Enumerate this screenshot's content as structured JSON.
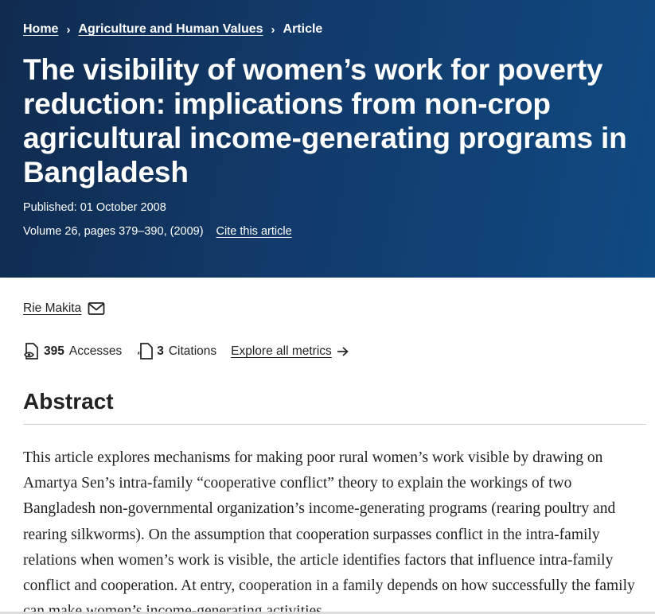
{
  "breadcrumb": {
    "items": [
      "Home",
      "Agriculture and Human Values"
    ],
    "current": "Article"
  },
  "article": {
    "title": "The visibility of women’s work for poverty reduction: implications from non-crop agricultural income-generating programs in Bangladesh",
    "published": "Published: 01 October 2008",
    "volume": "Volume 26, pages 379–390, (2009)",
    "cite_label": "Cite this article"
  },
  "author": {
    "name": "Rie Makita",
    "email_icon": "envelope-icon"
  },
  "metrics": {
    "accesses_count": "395",
    "accesses_label": "Accesses",
    "citations_count": "3",
    "citations_label": "Citations",
    "explore_label": "Explore all metrics",
    "accesses_icon": "eye-document-icon",
    "citations_icon": "quote-document-icon",
    "explore_icon": "arrow-right-icon"
  },
  "abstract": {
    "heading": "Abstract",
    "text": "This article explores mechanisms for making poor rural women’s work visible by drawing on Amartya Sen’s intra-family “cooperative conflict” theory to explain the workings of two Bangladesh non-governmental organization’s income-generating programs (rearing poultry and rearing silkworms). On the assumption that cooperation surpasses conflict in the intra-family relations when women’s work is visible, the article identifies factors that influence intra-family conflict and cooperation. At entry, cooperation in a family depends on how successfully the family can make women’s income-generating activities"
  },
  "colors": {
    "hero_start": "#0f2b4f",
    "hero_end": "#0f4a82",
    "text": "#222222",
    "divider": "#cfcfcf"
  }
}
